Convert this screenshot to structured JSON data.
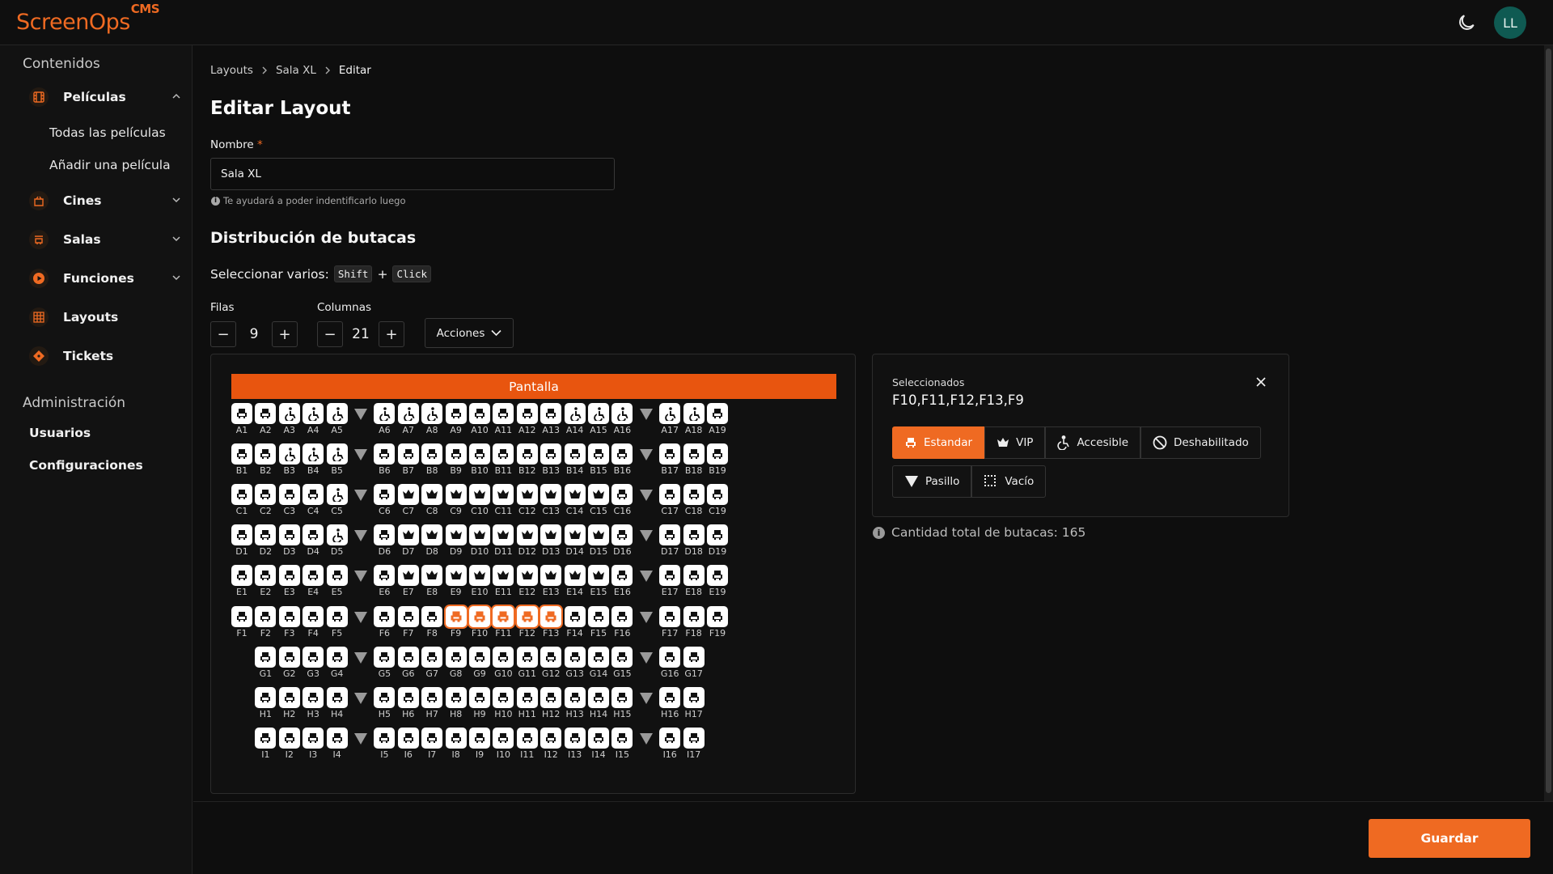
{
  "app": {
    "logo_text": "ScreenOps",
    "logo_sup": "CMS",
    "user_initials": "LL"
  },
  "sidebar": {
    "contenidos_title": "Contenidos",
    "peliculas": "Películas",
    "todas": "Todas las películas",
    "anadir": "Añadir una película",
    "cines": "Cines",
    "salas": "Salas",
    "funciones": "Funciones",
    "layouts": "Layouts",
    "tickets": "Tickets",
    "admin_title": "Administración",
    "usuarios": "Usuarios",
    "configuraciones": "Configuraciones"
  },
  "breadcrumb": {
    "c1": "Layouts",
    "c2": "Sala XL",
    "c3": "Editar"
  },
  "page": {
    "title": "Editar Layout",
    "name_label": "Nombre",
    "name_required": "*",
    "name_value": "Sala XL",
    "name_hint": "Te ayudará a poder indentificarlo luego",
    "section_title": "Distribución de butacas",
    "multi_text": "Seleccionar varios:",
    "key1": "Shift",
    "plus": "+",
    "key2": "Click"
  },
  "controls": {
    "filas_label": "Filas",
    "filas_value": "9",
    "columnas_label": "Columnas",
    "columnas_value": "21",
    "acciones": "Acciones"
  },
  "seatmap": {
    "screen_label": "Pantalla",
    "columns": 21,
    "rows": [
      {
        "letter": "A",
        "seats": [
          "s",
          "s",
          "a",
          "a",
          "a",
          "p",
          "a",
          "a",
          "a",
          "s",
          "s",
          "s",
          "s",
          "s",
          "a",
          "a",
          "a",
          "p",
          "a",
          "a",
          "s"
        ]
      },
      {
        "letter": "B",
        "seats": [
          "s",
          "s",
          "a",
          "a",
          "a",
          "p",
          "s",
          "s",
          "s",
          "s",
          "s",
          "s",
          "s",
          "s",
          "s",
          "s",
          "s",
          "p",
          "s",
          "s",
          "s"
        ]
      },
      {
        "letter": "C",
        "seats": [
          "s",
          "s",
          "s",
          "s",
          "a",
          "p",
          "s",
          "v",
          "v",
          "v",
          "v",
          "v",
          "v",
          "v",
          "v",
          "v",
          "s",
          "p",
          "s",
          "s",
          "s"
        ]
      },
      {
        "letter": "D",
        "seats": [
          "s",
          "s",
          "s",
          "s",
          "a",
          "p",
          "s",
          "v",
          "v",
          "v",
          "v",
          "v",
          "v",
          "v",
          "v",
          "v",
          "s",
          "p",
          "s",
          "s",
          "s"
        ]
      },
      {
        "letter": "E",
        "seats": [
          "s",
          "s",
          "s",
          "s",
          "s",
          "p",
          "s",
          "v",
          "v",
          "v",
          "v",
          "v",
          "v",
          "v",
          "v",
          "v",
          "s",
          "p",
          "s",
          "s",
          "s"
        ]
      },
      {
        "letter": "F",
        "seats": [
          "s",
          "s",
          "s",
          "s",
          "s",
          "p",
          "s",
          "s",
          "s",
          "s",
          "s",
          "s",
          "s",
          "s",
          "s",
          "s",
          "s",
          "p",
          "s",
          "s",
          "s"
        ]
      },
      {
        "letter": "G",
        "seats": [
          "e",
          "s",
          "s",
          "s",
          "s",
          "p",
          "s",
          "s",
          "s",
          "s",
          "s",
          "s",
          "s",
          "s",
          "s",
          "s",
          "s",
          "p",
          "s",
          "s",
          "e"
        ]
      },
      {
        "letter": "H",
        "seats": [
          "e",
          "s",
          "s",
          "s",
          "s",
          "p",
          "s",
          "s",
          "s",
          "s",
          "s",
          "s",
          "s",
          "s",
          "s",
          "s",
          "s",
          "p",
          "s",
          "s",
          "e"
        ]
      },
      {
        "letter": "I",
        "seats": [
          "e",
          "s",
          "s",
          "s",
          "s",
          "p",
          "s",
          "s",
          "s",
          "s",
          "s",
          "s",
          "s",
          "s",
          "s",
          "s",
          "s",
          "p",
          "s",
          "s",
          "e"
        ]
      }
    ],
    "selected": [
      "F9",
      "F10",
      "F11",
      "F12",
      "F13"
    ]
  },
  "selection": {
    "title": "Seleccionados",
    "value": "F10,F11,F12,F13,F9",
    "types": [
      "Estandar",
      "VIP",
      "Accesible",
      "Deshabilitado"
    ],
    "types2": [
      "Pasillo",
      "Vacío"
    ],
    "active_type": "Estandar"
  },
  "total_text": "Cantidad total de butacas: 165",
  "actions": {
    "save": "Guardar"
  },
  "colors": {
    "accent": "#ef6a22",
    "screen": "#e8550f",
    "avatar": "#0f5a52"
  }
}
